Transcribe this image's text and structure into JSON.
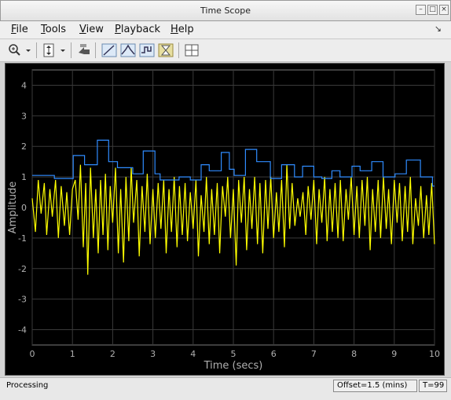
{
  "window": {
    "title": "Time Scope"
  },
  "menu": {
    "items": [
      "File",
      "Tools",
      "View",
      "Playback",
      "Help"
    ]
  },
  "toolbar": {
    "buttons": [
      "zoom-in-icon",
      "autoscale-icon",
      "restore-view-icon",
      "data-cursors-icon",
      "peak-finder-icon",
      "signal-statistics-icon",
      "bilevel-measurements-icon",
      "layout-icon"
    ]
  },
  "status": {
    "left": "Processing",
    "offset": "Offset=1.5 (mins)",
    "time": "T=99"
  },
  "chart_data": {
    "type": "line",
    "xlabel": "Time (secs)",
    "ylabel": "Amplitude",
    "xlim": [
      0,
      10
    ],
    "ylim": [
      -4.5,
      4.5
    ],
    "xticks": [
      0,
      1,
      2,
      3,
      4,
      5,
      6,
      7,
      8,
      9,
      10
    ],
    "yticks": [
      -4,
      -3,
      -2,
      -1,
      0,
      1,
      2,
      3,
      4
    ],
    "grid": true,
    "colors": {
      "background": "#000000",
      "grid": "#3a3a3a",
      "axes_text": "#b0b0b0",
      "yellow": "#ffff00",
      "blue": "#2f8cff"
    },
    "series": [
      {
        "color": "yellow",
        "x": [
          0,
          0.08,
          0.15,
          0.22,
          0.3,
          0.36,
          0.44,
          0.5,
          0.58,
          0.65,
          0.72,
          0.8,
          0.86,
          0.93,
          1.0,
          1.07,
          1.14,
          1.2,
          1.27,
          1.33,
          1.38,
          1.45,
          1.52,
          1.58,
          1.64,
          1.7,
          1.76,
          1.82,
          1.88,
          1.94,
          2.0,
          2.07,
          2.14,
          2.2,
          2.27,
          2.33,
          2.4,
          2.46,
          2.52,
          2.6,
          2.66,
          2.73,
          2.8,
          2.86,
          2.93,
          3.0,
          3.06,
          3.13,
          3.2,
          3.27,
          3.33,
          3.4,
          3.46,
          3.53,
          3.6,
          3.66,
          3.73,
          3.8,
          3.86,
          3.93,
          4.0,
          4.07,
          4.13,
          4.2,
          4.27,
          4.33,
          4.4,
          4.46,
          4.53,
          4.6,
          4.66,
          4.73,
          4.8,
          4.86,
          4.93,
          5.0,
          5.07,
          5.13,
          5.2,
          5.27,
          5.33,
          5.4,
          5.46,
          5.53,
          5.6,
          5.66,
          5.73,
          5.8,
          5.86,
          5.93,
          6.0,
          6.07,
          6.13,
          6.2,
          6.27,
          6.33,
          6.4,
          6.46,
          6.53,
          6.6,
          6.66,
          6.73,
          6.8,
          6.86,
          6.93,
          7.0,
          7.07,
          7.13,
          7.2,
          7.27,
          7.33,
          7.4,
          7.46,
          7.53,
          7.6,
          7.66,
          7.73,
          7.8,
          7.86,
          7.93,
          8.0,
          8.07,
          8.13,
          8.2,
          8.27,
          8.33,
          8.4,
          8.46,
          8.53,
          8.6,
          8.66,
          8.73,
          8.8,
          8.86,
          8.93,
          9.0,
          9.07,
          9.13,
          9.2,
          9.27,
          9.33,
          9.4,
          9.46,
          9.53,
          9.6,
          9.66,
          9.73,
          9.8,
          9.86,
          9.93,
          10.0
        ],
        "values": [
          0.3,
          -0.8,
          0.9,
          -0.2,
          0.8,
          -0.9,
          0.6,
          -0.3,
          0.9,
          -1.0,
          0.7,
          -0.6,
          0.5,
          -0.9,
          0.6,
          0.9,
          -0.4,
          1.4,
          -1.3,
          0.8,
          -2.2,
          1.3,
          -1.0,
          0.6,
          -1.5,
          0.9,
          -0.9,
          1.1,
          -1.4,
          0.7,
          -0.5,
          1.3,
          -1.5,
          0.6,
          -1.8,
          1.0,
          -1.1,
          1.3,
          -0.5,
          0.9,
          -1.6,
          0.7,
          -0.8,
          1.1,
          -1.2,
          0.6,
          -1.0,
          0.8,
          -0.7,
          0.9,
          -1.5,
          0.6,
          -0.8,
          1.0,
          -1.3,
          0.7,
          -0.9,
          0.8,
          -1.1,
          0.5,
          -0.7,
          0.9,
          -1.6,
          0.4,
          -0.8,
          1.0,
          -1.2,
          0.6,
          -0.9,
          0.8,
          -1.5,
          0.7,
          -0.3,
          1.0,
          -1.0,
          0.6,
          -1.9,
          0.9,
          -0.5,
          1.0,
          -1.4,
          0.6,
          -0.7,
          1.0,
          -1.2,
          0.8,
          -1.5,
          0.9,
          -0.7,
          1.0,
          -1.0,
          0.5,
          -0.8,
          0.9,
          -1.3,
          1.4,
          -0.7,
          0.8,
          -0.6,
          0.3,
          -0.3,
          0.5,
          -0.9,
          0.7,
          -0.4,
          0.9,
          -1.2,
          0.6,
          -0.5,
          1.0,
          -1.1,
          0.6,
          -0.8,
          0.8,
          -1.0,
          0.9,
          -1.1,
          0.6,
          -0.4,
          1.0,
          -0.9,
          0.7,
          -1.0,
          0.9,
          -0.6,
          1.0,
          -1.4,
          0.6,
          -0.8,
          0.9,
          -1.0,
          1.0,
          -0.7,
          0.6,
          -1.2,
          0.9,
          -0.5,
          0.8,
          -1.1,
          0.7,
          -0.8,
          1.0,
          -1.2,
          0.3,
          -0.6,
          0.7,
          -1.0,
          0.4,
          -0.9,
          0.8,
          -1.2
        ]
      },
      {
        "color": "blue",
        "x": [
          0,
          0.55,
          0.55,
          1.02,
          1.02,
          1.3,
          1.3,
          1.62,
          1.62,
          1.9,
          1.9,
          2.12,
          2.12,
          2.5,
          2.5,
          2.76,
          2.76,
          3.05,
          3.05,
          3.18,
          3.18,
          3.65,
          3.65,
          3.93,
          3.93,
          4.2,
          4.2,
          4.4,
          4.4,
          4.7,
          4.7,
          4.9,
          4.9,
          5.02,
          5.02,
          5.3,
          5.3,
          5.58,
          5.58,
          5.92,
          5.92,
          6.2,
          6.2,
          6.52,
          6.52,
          6.72,
          6.72,
          7.0,
          7.0,
          7.2,
          7.2,
          7.45,
          7.45,
          7.65,
          7.65,
          7.95,
          7.95,
          8.15,
          8.15,
          8.44,
          8.44,
          8.72,
          8.72,
          9.02,
          9.02,
          9.3,
          9.3,
          9.65,
          9.65,
          9.95,
          9.95,
          10.0
        ],
        "values": [
          1.05,
          1.05,
          0.95,
          0.95,
          1.7,
          1.7,
          1.4,
          1.4,
          2.2,
          2.2,
          1.5,
          1.5,
          1.3,
          1.3,
          1.1,
          1.1,
          1.85,
          1.85,
          1.1,
          1.1,
          0.9,
          0.9,
          1.0,
          1.0,
          0.9,
          0.9,
          1.4,
          1.4,
          1.2,
          1.2,
          1.8,
          1.8,
          1.25,
          1.25,
          1.05,
          1.05,
          1.9,
          1.9,
          1.5,
          1.5,
          0.95,
          0.95,
          1.4,
          1.4,
          1.0,
          1.0,
          1.35,
          1.35,
          1.0,
          1.0,
          0.95,
          0.95,
          1.2,
          1.2,
          1.0,
          1.0,
          1.35,
          1.35,
          1.2,
          1.2,
          1.5,
          1.5,
          1.0,
          1.0,
          1.1,
          1.1,
          1.55,
          1.55,
          1.0,
          1.0,
          0.7,
          0.7
        ]
      }
    ]
  }
}
